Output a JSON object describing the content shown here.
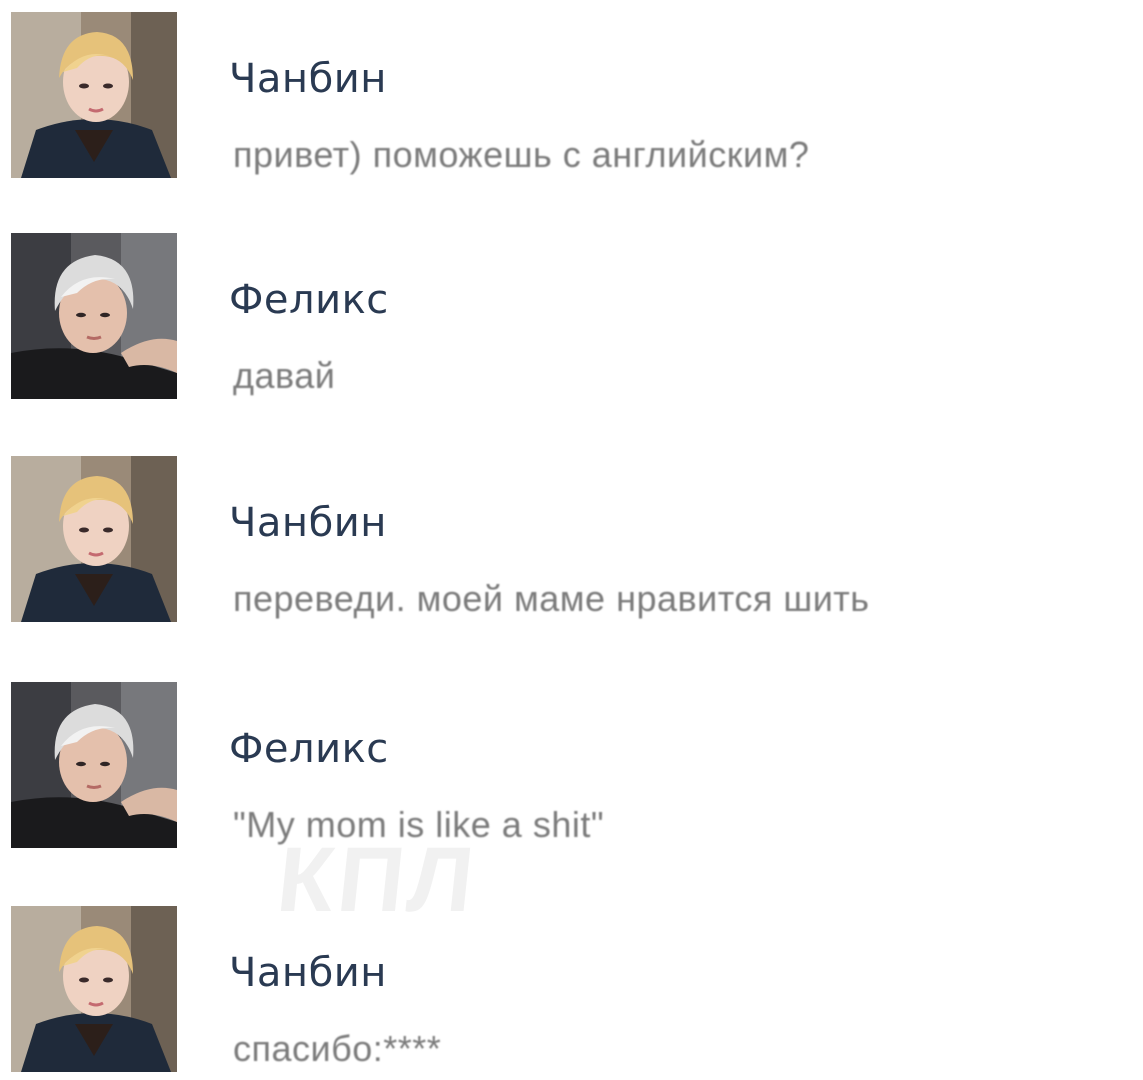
{
  "watermark": "КПЛ",
  "messages": [
    {
      "author": "Чанбин",
      "avatar": "avatar-changbin",
      "text": "привет) поможешь с английским?"
    },
    {
      "author": "Феликс",
      "avatar": "avatar-felix",
      "text": "давай"
    },
    {
      "author": "Чанбин",
      "avatar": "avatar-changbin",
      "text": "переведи. моей маме нравится шить"
    },
    {
      "author": "Феликс",
      "avatar": "avatar-felix",
      "text": "\"My mom is like a shit\""
    },
    {
      "author": "Чанбин",
      "avatar": "avatar-changbin",
      "text": "спасибо:****"
    }
  ],
  "colors": {
    "author": "#2a3a52",
    "message_text": "#7b7b7b",
    "background": "#ffffff"
  }
}
